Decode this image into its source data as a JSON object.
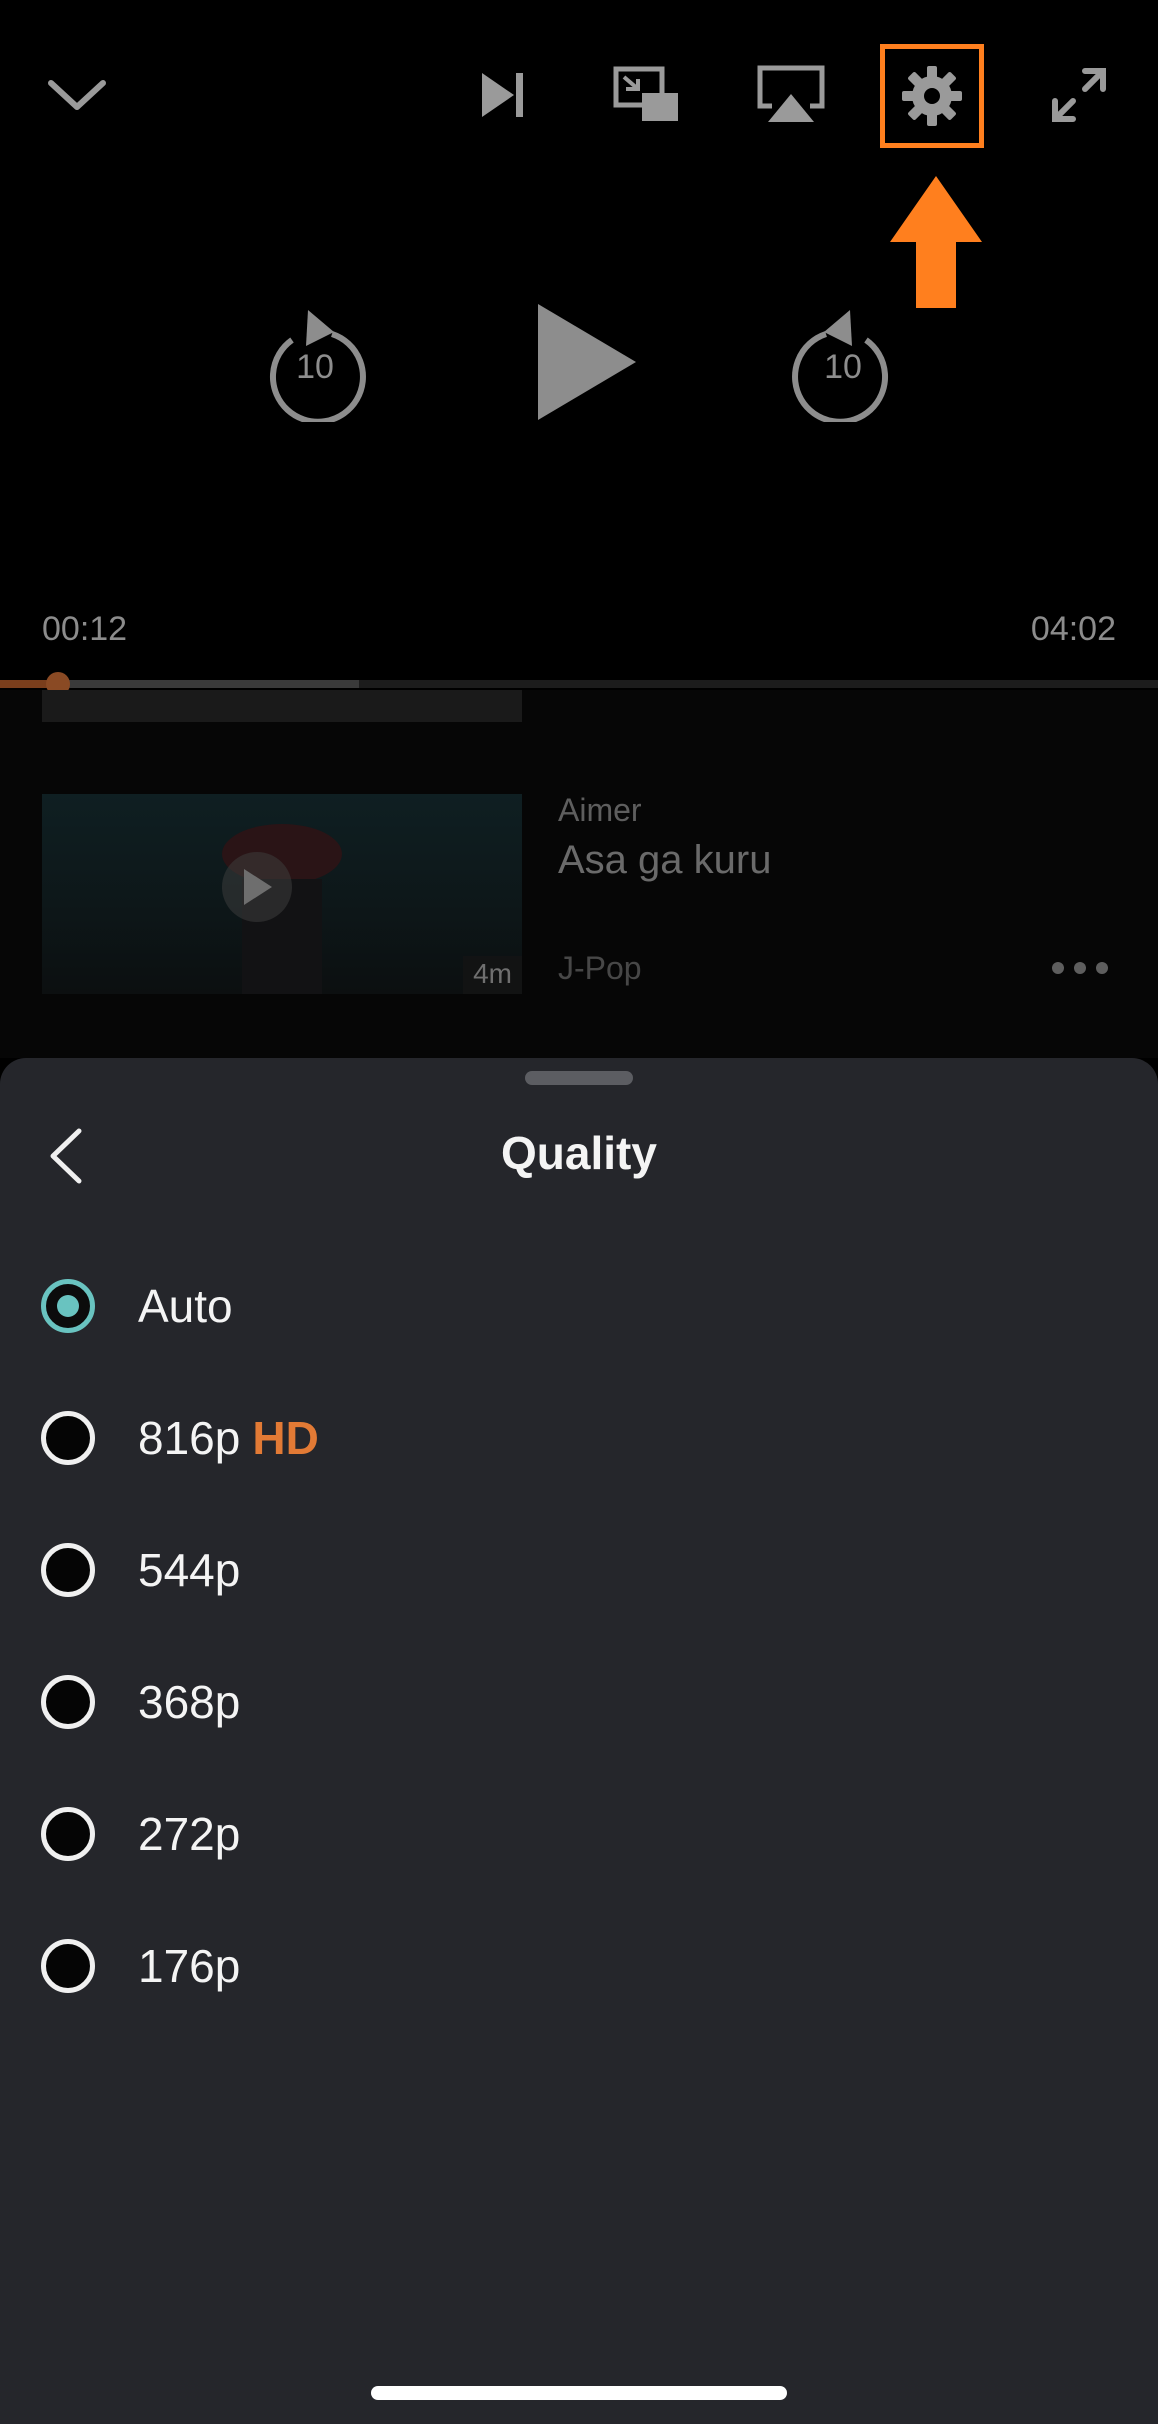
{
  "player": {
    "current_time": "00:12",
    "duration": "04:02",
    "progress_fraction": 0.05,
    "buffered_fraction": 0.31,
    "skip_back_seconds": "10",
    "skip_forward_seconds": "10",
    "icons": [
      "chevron-down-icon",
      "skip-next-icon",
      "picture-in-picture-icon",
      "airplay-icon",
      "gear-icon",
      "fullscreen-icon",
      "replay-10-icon",
      "play-icon",
      "forward-10-icon"
    ]
  },
  "annotation": {
    "color": "#ff7f1e",
    "target": "gear-icon"
  },
  "queue_item": {
    "artist": "Aimer",
    "title": "Asa ga kuru",
    "genre": "J-Pop",
    "duration_badge": "4m"
  },
  "quality_sheet": {
    "title": "Quality",
    "selected_index": 0,
    "accent_color": "#69c3c0",
    "hd_color": "#e27a35",
    "options": [
      {
        "label": "Auto",
        "badge": ""
      },
      {
        "label": "816p",
        "badge": "HD"
      },
      {
        "label": "544p",
        "badge": ""
      },
      {
        "label": "368p",
        "badge": ""
      },
      {
        "label": "272p",
        "badge": ""
      },
      {
        "label": "176p",
        "badge": ""
      }
    ]
  }
}
